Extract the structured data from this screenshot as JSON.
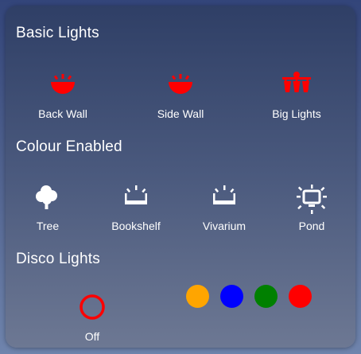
{
  "sections": [
    {
      "title": "Basic Lights",
      "items": [
        {
          "label": "Back Wall",
          "icon": "wall-light-icon",
          "color": "#ff0000"
        },
        {
          "label": "Side Wall",
          "icon": "wall-light-icon",
          "color": "#ff0000"
        },
        {
          "label": "Big Lights",
          "icon": "chandelier-icon",
          "color": "#ff0000"
        }
      ]
    },
    {
      "title": "Colour Enabled",
      "items": [
        {
          "label": "Tree",
          "icon": "tree-icon",
          "color": "#ffffff"
        },
        {
          "label": "Bookshelf",
          "icon": "strip-light-icon",
          "color": "#ffffff"
        },
        {
          "label": "Vivarium",
          "icon": "strip-light-icon",
          "color": "#ffffff"
        },
        {
          "label": "Pond",
          "icon": "pond-light-icon",
          "color": "#ffffff"
        }
      ]
    },
    {
      "title": "Disco Lights",
      "items": [
        {
          "label": "Off",
          "icon": "power-ring-icon",
          "color": "#ff0000"
        }
      ]
    }
  ],
  "disco_colors": [
    {
      "name": "orange",
      "color": "#ffa500"
    },
    {
      "name": "blue",
      "color": "#0000ff"
    },
    {
      "name": "green",
      "color": "#008000"
    },
    {
      "name": "red",
      "color": "#ff0000"
    }
  ]
}
